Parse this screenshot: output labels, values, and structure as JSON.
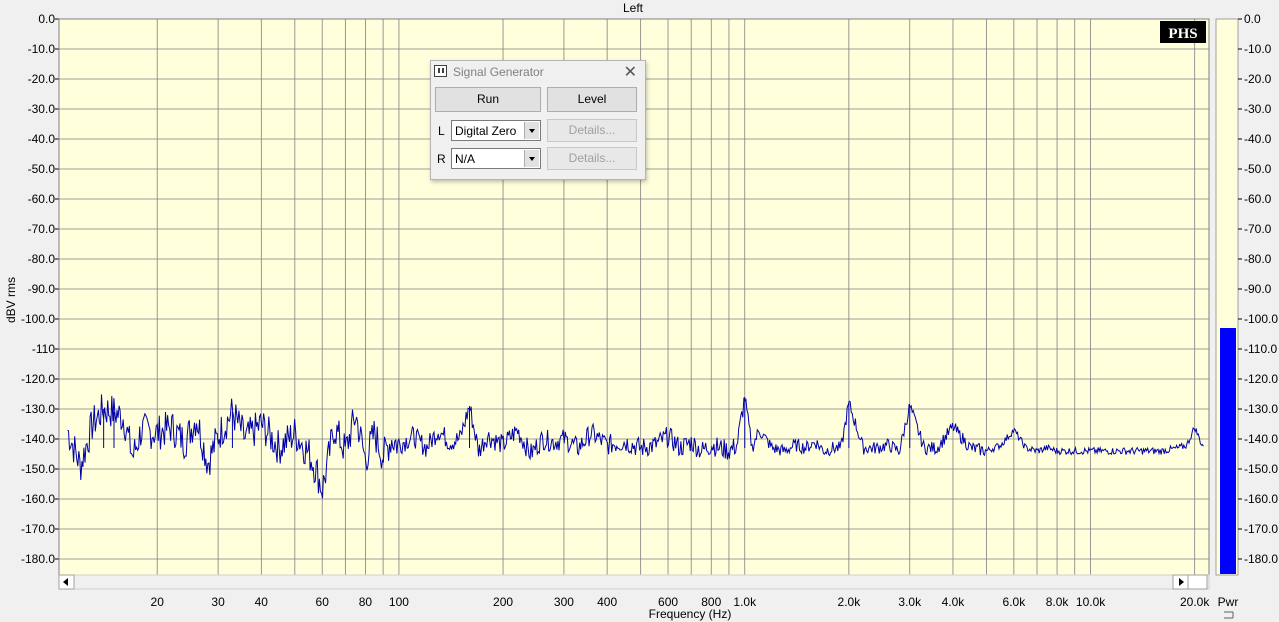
{
  "plot": {
    "title": "Left",
    "ylabel": "dBV rms",
    "xlabel": "Frequency (Hz)",
    "logo": "PHS",
    "y_ticks": [
      "0.0",
      "-10.0",
      "-20.0",
      "-30.0",
      "-40.0",
      "-50.0",
      "-60.0",
      "-70.0",
      "-80.0",
      "-90.0",
      "-100.0",
      "-110",
      "-120.0",
      "-130.0",
      "-140.0",
      "-150.0",
      "-160.0",
      "-170.0",
      "-180.0"
    ],
    "x_ticks": [
      {
        "f": 20,
        "label": "20"
      },
      {
        "f": 30,
        "label": "30"
      },
      {
        "f": 40,
        "label": "40"
      },
      {
        "f": 60,
        "label": "60"
      },
      {
        "f": 80,
        "label": "80"
      },
      {
        "f": 100,
        "label": "100"
      },
      {
        "f": 200,
        "label": "200"
      },
      {
        "f": 300,
        "label": "300"
      },
      {
        "f": 400,
        "label": "400"
      },
      {
        "f": 600,
        "label": "600"
      },
      {
        "f": 800,
        "label": "800"
      },
      {
        "f": 1000,
        "label": "1.0k"
      },
      {
        "f": 2000,
        "label": "2.0k"
      },
      {
        "f": 3000,
        "label": "3.0k"
      },
      {
        "f": 4000,
        "label": "4.0k"
      },
      {
        "f": 6000,
        "label": "6.0k"
      },
      {
        "f": 8000,
        "label": "8.0k"
      },
      {
        "f": 10000,
        "label": "10.0k"
      },
      {
        "f": 20000,
        "label": "20.0k"
      }
    ],
    "x_range": [
      10.4,
      22000
    ],
    "y_range": [
      -185,
      0
    ],
    "line_color": "#0000aa",
    "plot_bg": "#ffffdc",
    "grid_color": "#808080"
  },
  "meter": {
    "label": "Pwr",
    "level_db": -103,
    "bar_color": "#0000ff",
    "ticks": [
      "0.0",
      "-10.0",
      "-20.0",
      "-30.0",
      "-40.0",
      "-50.0",
      "-60.0",
      "-70.0",
      "-80.0",
      "-90.0",
      "-100.0",
      "-110.0",
      "-120.0",
      "-130.0",
      "-140.0",
      "-150.0",
      "-160.0",
      "-170.0",
      "-180.0"
    ]
  },
  "signal_generator": {
    "title": "Signal Generator",
    "run_label": "Run",
    "level_label": "Level",
    "left_label": "L",
    "right_label": "R",
    "left_value": "Digital Zero",
    "right_value": "N/A",
    "details_label": "Details..."
  },
  "chart_data": {
    "type": "line",
    "xlabel": "Frequency (Hz)",
    "ylabel": "dBV rms",
    "title": "Left",
    "xscale": "log",
    "xlim": [
      10.4,
      22000
    ],
    "ylim": [
      -185,
      0
    ],
    "grid": true,
    "noise_floor_db": -142,
    "series": [
      {
        "x": [
          11,
          12,
          13,
          14,
          15,
          16,
          17,
          18,
          20,
          22,
          24,
          26,
          28,
          30,
          33,
          36,
          40,
          45,
          50,
          55,
          58,
          60,
          62,
          65,
          70,
          75,
          80,
          85,
          90,
          95,
          100,
          110,
          120,
          130,
          140,
          150,
          160,
          170,
          180,
          200,
          220,
          240,
          260,
          280,
          300,
          330,
          360,
          400,
          450,
          500,
          550,
          600,
          650,
          700,
          750,
          800,
          850,
          900,
          950,
          1000,
          1050,
          1100,
          1200,
          1300,
          1400,
          1500,
          1600,
          1700,
          1800,
          1900,
          2000,
          2200,
          2400,
          2600,
          2800,
          3000,
          3300,
          3600,
          4000,
          4500,
          5000,
          5500,
          6000,
          6500,
          7000,
          7500,
          8000,
          9000,
          10000,
          11000,
          12000,
          14000,
          16000,
          18000,
          19000,
          20000,
          21000
        ],
        "y": [
          -137,
          -149,
          -135,
          -130,
          -131,
          -133,
          -146,
          -137,
          -138,
          -136,
          -141,
          -133,
          -148,
          -139,
          -131,
          -140,
          -135,
          -143,
          -138,
          -145,
          -151,
          -157,
          -149,
          -136,
          -144,
          -132,
          -147,
          -138,
          -146,
          -140,
          -142,
          -139,
          -143,
          -137,
          -141,
          -140,
          -129,
          -144,
          -139,
          -142,
          -137,
          -145,
          -140,
          -141,
          -140,
          -143,
          -138,
          -142,
          -141,
          -143,
          -142,
          -139,
          -143,
          -141,
          -144,
          -142,
          -143,
          -144,
          -142,
          -126,
          -143,
          -137,
          -143,
          -144,
          -142,
          -143,
          -141,
          -144,
          -143,
          -143,
          -128,
          -143,
          -143,
          -142,
          -144,
          -129,
          -143,
          -143,
          -136,
          -143,
          -144,
          -142,
          -137,
          -143,
          -144,
          -143,
          -144,
          -144,
          -144,
          -144,
          -144,
          -144,
          -144,
          -143,
          -142,
          -136,
          -142
        ]
      }
    ]
  }
}
